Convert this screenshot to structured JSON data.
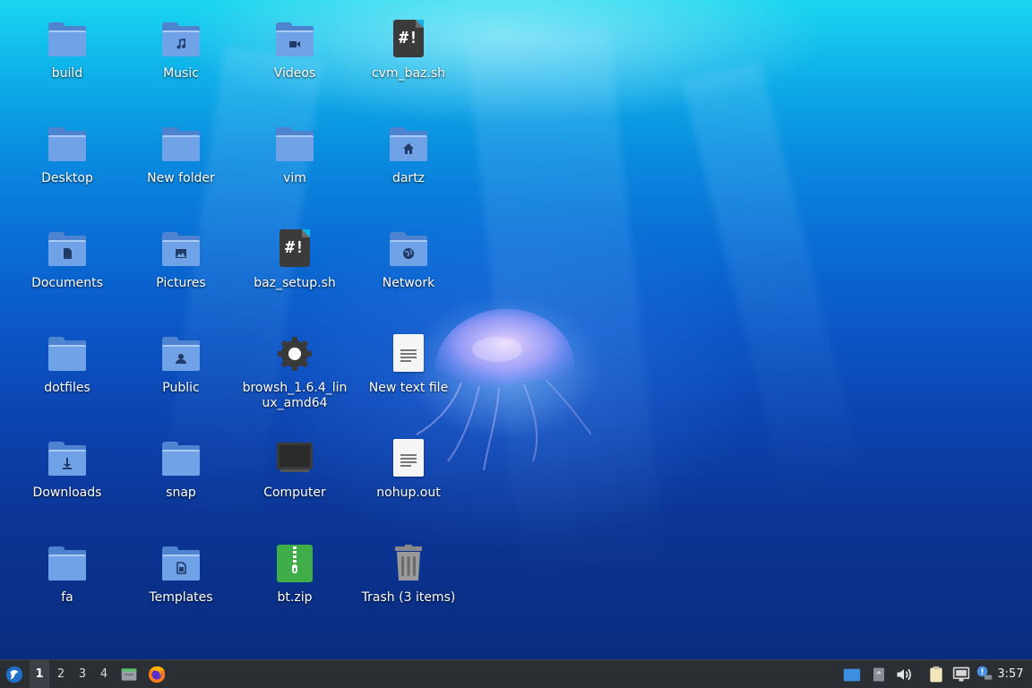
{
  "desktop_icons": [
    {
      "label": "build",
      "type": "folder",
      "emblem": "none"
    },
    {
      "label": "Music",
      "type": "folder",
      "emblem": "music-note"
    },
    {
      "label": "Videos",
      "type": "folder",
      "emblem": "video-camera"
    },
    {
      "label": "cvm_baz.sh",
      "type": "script",
      "glyph_text": "#!"
    },
    {
      "label": "Desktop",
      "type": "folder",
      "emblem": "none"
    },
    {
      "label": "New folder",
      "type": "folder",
      "emblem": "none"
    },
    {
      "label": "vim",
      "type": "folder",
      "emblem": "none"
    },
    {
      "label": "dartz",
      "type": "folder",
      "emblem": "home"
    },
    {
      "label": "Documents",
      "type": "folder",
      "emblem": "document"
    },
    {
      "label": "Pictures",
      "type": "folder",
      "emblem": "picture"
    },
    {
      "label": "baz_setup.sh",
      "type": "script",
      "glyph_text": "#!"
    },
    {
      "label": "Network",
      "type": "folder",
      "emblem": "globe"
    },
    {
      "label": "dotfiles",
      "type": "folder",
      "emblem": "none"
    },
    {
      "label": "Public",
      "type": "folder",
      "emblem": "person"
    },
    {
      "label": "browsh_1.6.4_linux_amd64",
      "type": "executable",
      "emblem": "gear"
    },
    {
      "label": "New text file",
      "type": "textfile"
    },
    {
      "label": "Downloads",
      "type": "folder",
      "emblem": "download-arrow"
    },
    {
      "label": "snap",
      "type": "folder",
      "emblem": "none"
    },
    {
      "label": "Computer",
      "type": "computer"
    },
    {
      "label": "nohup.out",
      "type": "textfile"
    },
    {
      "label": "fa",
      "type": "folder",
      "emblem": "none"
    },
    {
      "label": "Templates",
      "type": "folder",
      "emblem": "template"
    },
    {
      "label": "bt.zip",
      "type": "archive"
    },
    {
      "label": "Trash (3 items)",
      "type": "trash"
    }
  ],
  "taskbar": {
    "workspaces": [
      "1",
      "2",
      "3",
      "4"
    ],
    "active_workspace": "1",
    "launchers": [
      "app-menu-icon",
      "file-manager-icon",
      "firefox-icon"
    ],
    "tray_icons": [
      "window-list-icon",
      "notifications-icon",
      "volume-icon",
      "clipboard-icon",
      "network-icon",
      "updates-icon"
    ],
    "clock": "3:57"
  },
  "colors": {
    "folder_front": "#6fa2e6",
    "folder_back": "#4e84cf",
    "taskbar_bg": "#2b2f34",
    "wallpaper_top": "#19d6ef",
    "wallpaper_bottom": "#0a2c7e"
  }
}
